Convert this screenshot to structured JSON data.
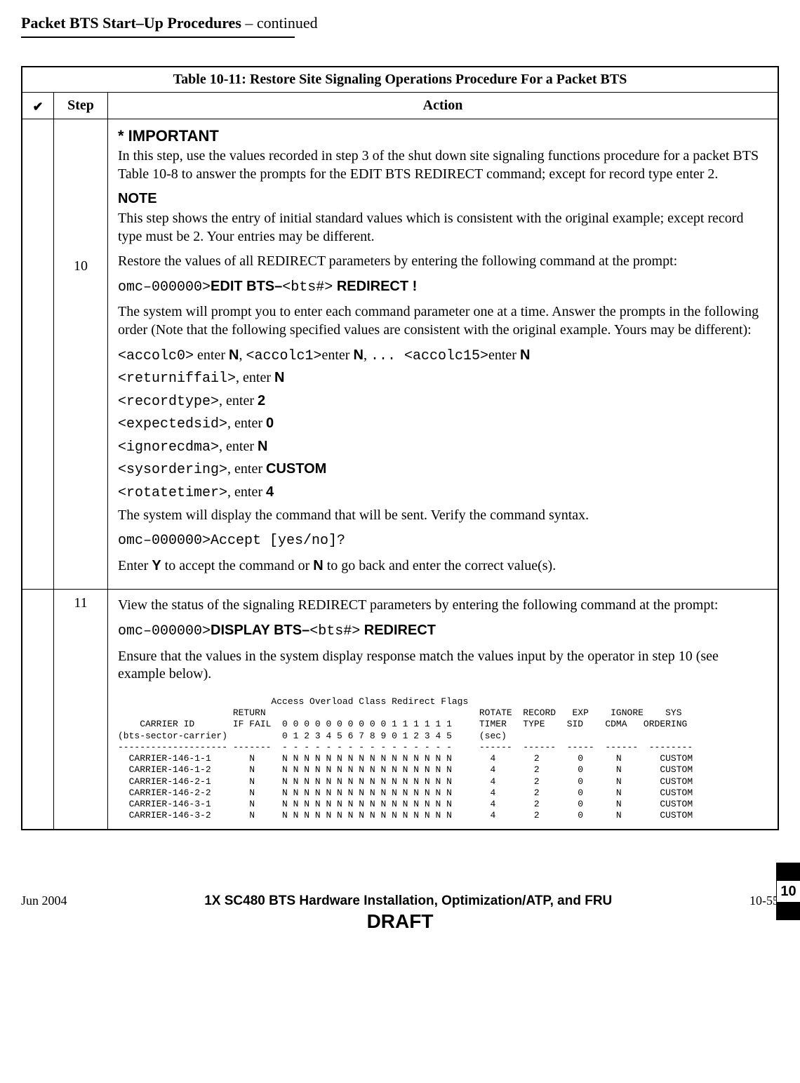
{
  "header": {
    "title": "Packet BTS Start–Up Procedures",
    "continued": "  – continued"
  },
  "table": {
    "caption_bold": "Table 10-11: ",
    "caption_rest": "Restore Site Signaling Operations Procedure For a Packet BTS",
    "check_header_glyph": "✔",
    "step_header": "Step",
    "action_header": "Action"
  },
  "step10": {
    "number": "10",
    "important_head": "* IMPORTANT",
    "important_para": "In this step, use the values recorded in step 3 of the shut down site signaling functions procedure for a packet BTS Table 10-8 to answer the prompts for the EDIT BTS REDIRECT command; except for record type enter 2.",
    "note_head": "NOTE",
    "note_para": "This step shows the entry of initial standard values which is consistent with the original example; except record type must be 2. Your entries may be different.",
    "restore_para": "Restore the values of all REDIRECT parameters by entering the following command at the prompt:",
    "cmd_prefix": "omc–000000>",
    "cmd_edit1": "EDIT BTS–",
    "cmd_var_bts": "<bts#>",
    "cmd_edit2": " REDIRECT !",
    "prompt_para": "The system will prompt you to enter each command parameter one at a time. Answer the prompts in the following order (Note that the following specified values are consistent with the original example. Yours may be different):",
    "ac_var0": "<accolc0>",
    "ac_txt1": " enter ",
    "ac_N": "N",
    "ac_sep": ", ",
    "ac_var1": "<accolc1>",
    "ac_txt_enter": "enter ",
    "ac_ellipsis": "... ",
    "ac_var15": "<accolc15>",
    "ret_var": "<returniffail>",
    "lbl_enter": ", enter ",
    "rec_var": "<recordtype>",
    "rec_val": "2",
    "exp_var": "<expectedsid>",
    "exp_val": "0",
    "ign_var": "<ignorecdma>",
    "sys_var": "<sysordering>",
    "sys_val": "CUSTOM",
    "rot_var": "<rotatetimer>",
    "rot_val": "4",
    "verify_para": "The system will display the command that will be sent. Verify the command syntax.",
    "accept_cmd": "Accept [yes/no]?",
    "enter_y_pre": "Enter ",
    "Y": "Y",
    "enter_y_mid": " to accept the command or ",
    "Nbold": "N",
    "enter_y_post": " to go back and enter the correct value(s)."
  },
  "step11": {
    "number": "11",
    "para1": "View the status of the signaling REDIRECT parameters by entering the following command at the prompt:",
    "cmd_prefix": "omc–000000>",
    "cmd_disp1": "DISPLAY BTS–",
    "cmd_var_bts": "<bts#>",
    "cmd_disp2": " REDIRECT",
    "para2": "Ensure that the values in the system display response match the values input by the operator in step 10 (see example below).",
    "terminal": "                            Access Overload Class Redirect Flags\n                     RETURN                                       ROTATE  RECORD   EXP    IGNORE    SYS\n    CARRIER ID       IF FAIL  0 0 0 0 0 0 0 0 0 0 1 1 1 1 1 1     TIMER   TYPE    SID    CDMA   ORDERING\n(bts-sector-carrier)          0 1 2 3 4 5 6 7 8 9 0 1 2 3 4 5     (sec)\n-------------------- -------  - - - - - - - - - - - - - - - -     ------  ------  -----  ------  --------\n  CARRIER-146-1-1       N     N N N N N N N N N N N N N N N N       4       2       0      N       CUSTOM\n  CARRIER-146-1-2       N     N N N N N N N N N N N N N N N N       4       2       0      N       CUSTOM\n  CARRIER-146-2-1       N     N N N N N N N N N N N N N N N N       4       2       0      N       CUSTOM\n  CARRIER-146-2-2       N     N N N N N N N N N N N N N N N N       4       2       0      N       CUSTOM\n  CARRIER-146-3-1       N     N N N N N N N N N N N N N N N N       4       2       0      N       CUSTOM\n  CARRIER-146-3-2       N     N N N N N N N N N N N N N N N N       4       2       0      N       CUSTOM"
  },
  "footer": {
    "left": "Jun 2004",
    "center": "1X SC480 BTS Hardware Installation, Optimization/ATP, and FRU",
    "right": "10-55",
    "draft": "DRAFT"
  },
  "sidetab": {
    "label": "10"
  }
}
